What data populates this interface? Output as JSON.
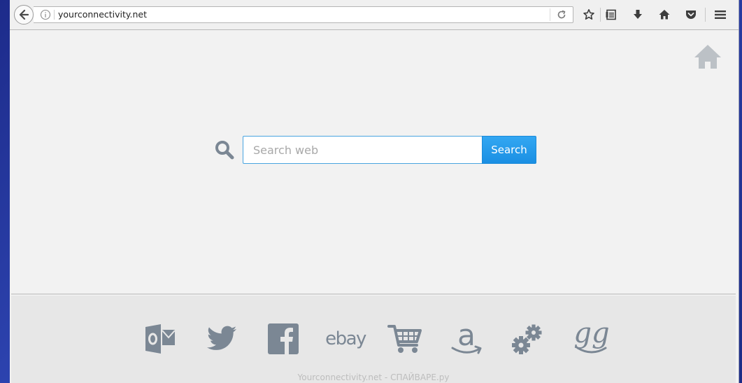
{
  "browser": {
    "url": "yourconnectivity.net"
  },
  "search": {
    "placeholder": "Search web",
    "button_label": "Search"
  },
  "dock": {
    "items": [
      {
        "name": "outlook-icon"
      },
      {
        "name": "twitter-icon"
      },
      {
        "name": "facebook-icon"
      },
      {
        "name": "ebay-icon",
        "label": "ebay"
      },
      {
        "name": "shopping-cart-icon"
      },
      {
        "name": "amazon-icon",
        "label": "a"
      },
      {
        "name": "settings-icon"
      },
      {
        "name": "gg-icon",
        "label": "gg"
      }
    ]
  },
  "watermark": "Yourconnectivity.net - СПАЙВАРЕ.ру",
  "colors": {
    "accent": "#1a8fe3",
    "icon_gray": "#7b8794",
    "page_bg": "#f2f2f2"
  }
}
